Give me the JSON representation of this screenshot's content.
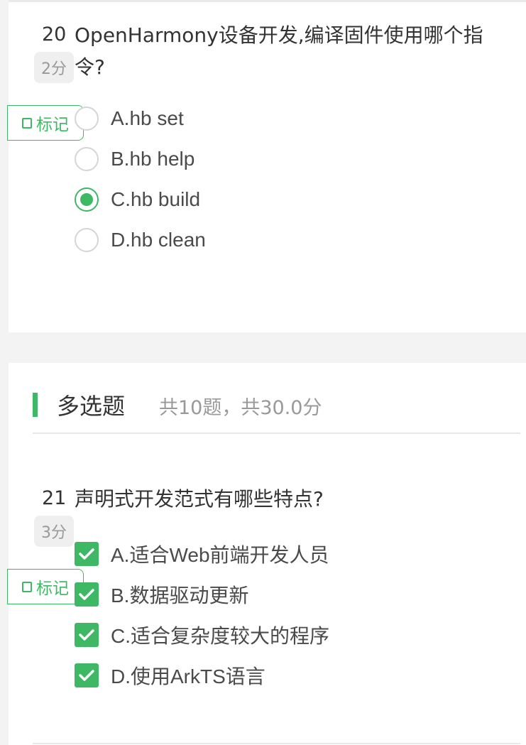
{
  "q20": {
    "number": "20",
    "text_line1": "OpenHarmony设备开发,编译固件使用哪个指",
    "text_line2": "令?",
    "score": "2分",
    "mark_label": "标记",
    "options": [
      {
        "label": "A.hb set",
        "checked": false
      },
      {
        "label": "B.hb help",
        "checked": false
      },
      {
        "label": "C.hb build",
        "checked": true
      },
      {
        "label": "D.hb clean",
        "checked": false
      }
    ]
  },
  "section": {
    "title": "多选题",
    "info": "共10题，共30.0分"
  },
  "q21": {
    "number": "21",
    "text": "声明式开发范式有哪些特点?",
    "score": "3分",
    "mark_label": "标记",
    "options": [
      {
        "label": "A.适合Web前端开发人员",
        "checked": true
      },
      {
        "label": "B.数据驱动更新",
        "checked": true
      },
      {
        "label": "C.适合复杂度较大的程序",
        "checked": true
      },
      {
        "label": "D.使用ArkTS语言",
        "checked": true
      }
    ]
  },
  "colors": {
    "accent": "#3fb866",
    "background": "#f3f3f3",
    "card": "#ffffff"
  }
}
